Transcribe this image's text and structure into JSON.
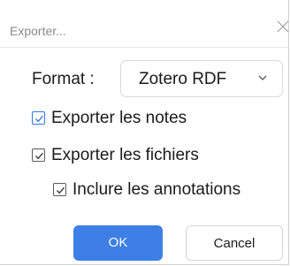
{
  "dialog": {
    "title": "Exporter...",
    "close_icon": "close-icon"
  },
  "format": {
    "label": "Format :",
    "selected": "Zotero RDF",
    "chevron_icon": "chevron-down-icon"
  },
  "options": [
    {
      "label": "Exporter les notes",
      "checked": true
    },
    {
      "label": "Exporter les fichiers",
      "checked": true
    },
    {
      "label": "Inclure les annotations",
      "checked": true
    }
  ],
  "buttons": {
    "ok_label": "OK",
    "cancel_label": "Cancel"
  },
  "colors": {
    "primary": "#3d7fe6",
    "focus_check": "#2f79e6",
    "check": "#3a3a3a",
    "title_text": "#8a8a8a"
  }
}
